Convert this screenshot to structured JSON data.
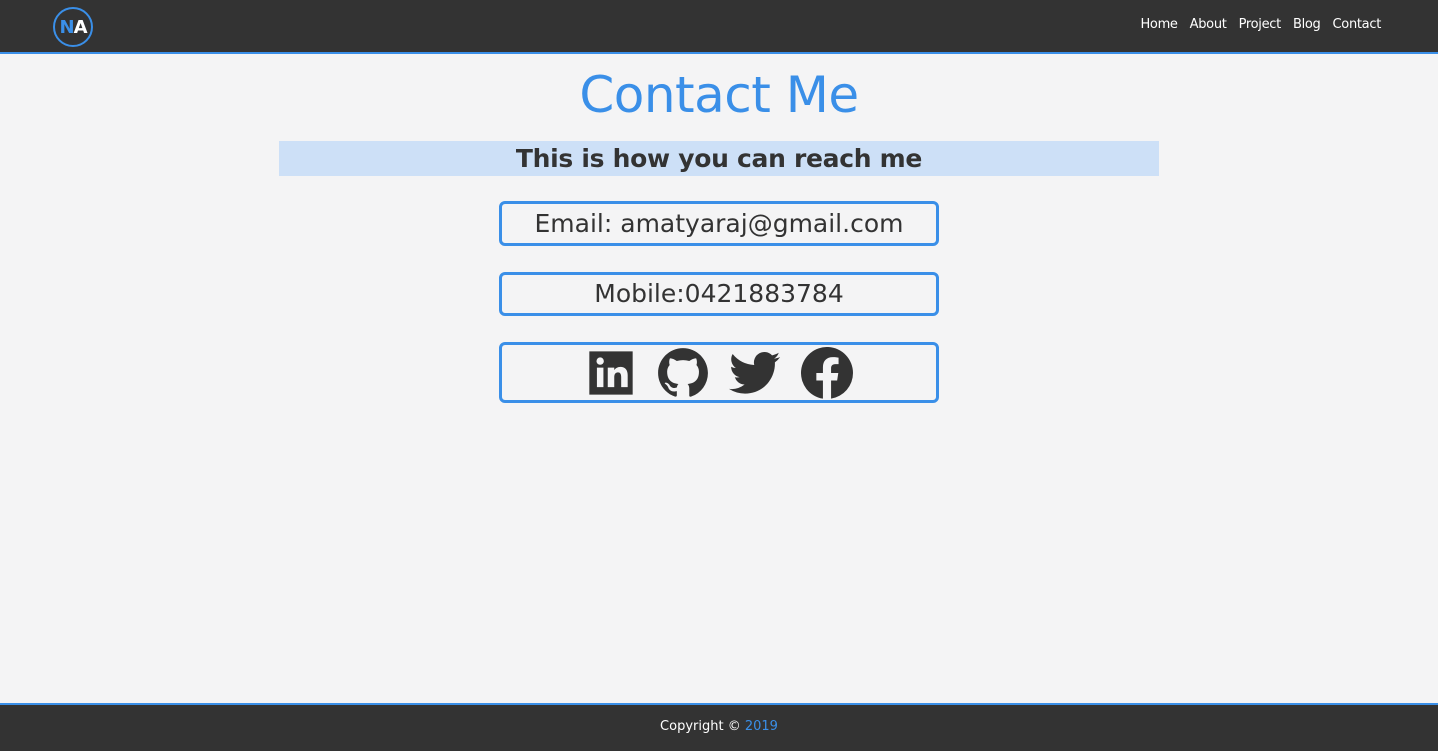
{
  "nav": {
    "logo": {
      "letter1": "N",
      "letter2": "A"
    },
    "links": [
      "Home",
      "About",
      "Project",
      "Blog",
      "Contact"
    ]
  },
  "main": {
    "title": "Contact Me",
    "subtitle": "This is how you can reach me",
    "email": "Email: amatyaraj@gmail.com",
    "mobile": "Mobile:0421883784",
    "social_icons": [
      "linkedin-icon",
      "github-icon",
      "twitter-icon",
      "facebook-icon"
    ]
  },
  "footer": {
    "copyright": "Copyright © ",
    "year": "2019"
  },
  "colors": {
    "accent": "#3a8fe8",
    "navbar": "#333333",
    "background": "#f4f4f5",
    "subtitle_bg": "#cde0f7",
    "text": "#333333"
  }
}
